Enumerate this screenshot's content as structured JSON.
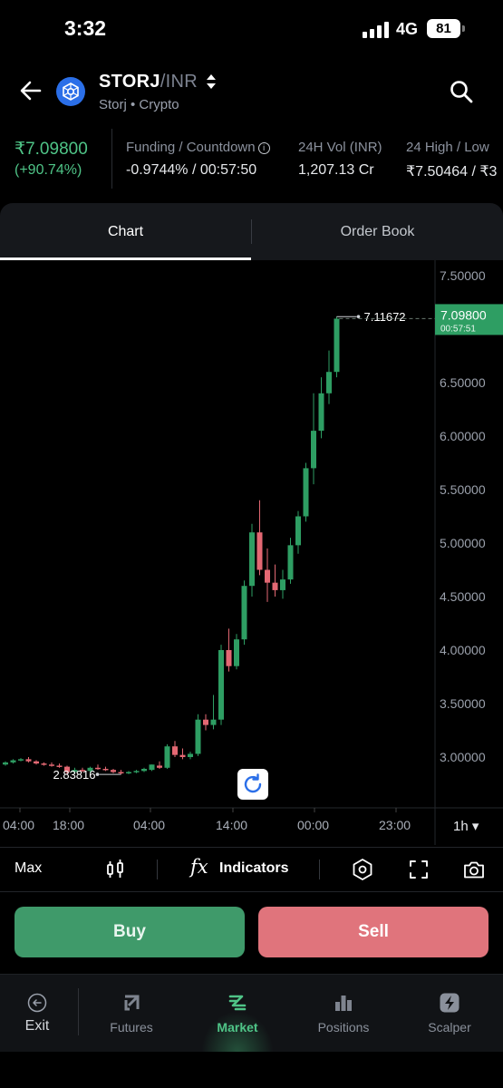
{
  "status_bar": {
    "time": "3:32",
    "network": "4G",
    "battery": "81"
  },
  "header": {
    "base": "STORJ",
    "quote": "/INR",
    "subtitle": "Storj • Crypto",
    "icons": [
      "back-arrow-icon",
      "storj-logo-icon",
      "sort-icon",
      "search-icon"
    ]
  },
  "ticker": {
    "price": "₹7.09800",
    "change": "(+90.74%)",
    "funding_label": "Funding / Countdown",
    "funding_value": "-0.9744% / 00:57:50",
    "vol_label": "24H Vol (INR)",
    "vol_value": "1,207.13 Cr",
    "high_label": "24 High / Low",
    "high_value": "₹7.50464 / ₹3",
    "accent_color": "#4fc487"
  },
  "tabs": {
    "chart": "Chart",
    "order_book": "Order Book",
    "active": "Chart"
  },
  "chart": {
    "timeframe": "1h ▾",
    "current_price_tag": "7.09800",
    "countdown_tag": "00:57:51",
    "high_marker": "7.11672",
    "low_marker": "2.83816",
    "up_color": "#2e9e63",
    "down_color": "#e36873"
  },
  "chart_data": {
    "type": "candlestick",
    "y_ticks": [
      "7.50000",
      "7.00000",
      "6.50000",
      "6.00000",
      "5.50000",
      "5.00000",
      "4.50000",
      "4.00000",
      "3.50000",
      "3.00000"
    ],
    "y_tick_values": [
      7.5,
      7.0,
      6.5,
      6.0,
      5.5,
      5.0,
      4.5,
      4.0,
      3.5,
      3.0
    ],
    "x_ticks": [
      "04:00",
      "18:00",
      "04:00",
      "14:00",
      "00:00",
      "23:00"
    ],
    "ylim": [
      2.55,
      7.75
    ],
    "candles": [
      [
        2.93,
        2.96,
        2.92,
        2.95
      ],
      [
        2.95,
        2.98,
        2.94,
        2.97
      ],
      [
        2.97,
        2.99,
        2.96,
        2.98
      ],
      [
        2.98,
        3.0,
        2.95,
        2.96
      ],
      [
        2.96,
        2.97,
        2.93,
        2.94
      ],
      [
        2.94,
        2.95,
        2.92,
        2.93
      ],
      [
        2.93,
        2.95,
        2.91,
        2.92
      ],
      [
        2.92,
        2.94,
        2.9,
        2.91
      ],
      [
        2.91,
        2.92,
        2.84,
        2.86
      ],
      [
        2.86,
        2.9,
        2.84,
        2.88
      ],
      [
        2.88,
        2.9,
        2.86,
        2.87
      ],
      [
        2.87,
        2.91,
        2.85,
        2.9
      ],
      [
        2.9,
        2.93,
        2.88,
        2.89
      ],
      [
        2.89,
        2.91,
        2.87,
        2.88
      ],
      [
        2.88,
        2.89,
        2.85,
        2.86
      ],
      [
        2.86,
        2.88,
        2.83816,
        2.85
      ],
      [
        2.85,
        2.87,
        2.84,
        2.86
      ],
      [
        2.86,
        2.88,
        2.85,
        2.87
      ],
      [
        2.87,
        2.9,
        2.86,
        2.89
      ],
      [
        2.88,
        2.93,
        2.87,
        2.93
      ],
      [
        2.92,
        2.96,
        2.89,
        2.9
      ],
      [
        2.9,
        3.12,
        2.89,
        3.1
      ],
      [
        3.1,
        3.15,
        3.0,
        3.02
      ],
      [
        3.02,
        3.08,
        2.98,
        3.0
      ],
      [
        3.0,
        3.05,
        2.98,
        3.03
      ],
      [
        3.03,
        3.4,
        3.01,
        3.35
      ],
      [
        3.35,
        3.4,
        3.25,
        3.3
      ],
      [
        3.3,
        3.58,
        3.26,
        3.35
      ],
      [
        3.35,
        4.05,
        3.3,
        4.0
      ],
      [
        4.0,
        4.2,
        3.8,
        3.85
      ],
      [
        3.85,
        4.15,
        3.82,
        4.1
      ],
      [
        4.1,
        4.65,
        4.05,
        4.6
      ],
      [
        4.6,
        5.18,
        4.5,
        5.1
      ],
      [
        5.1,
        5.4,
        4.7,
        4.75
      ],
      [
        4.75,
        4.95,
        4.45,
        4.63
      ],
      [
        4.63,
        4.8,
        4.5,
        4.56
      ],
      [
        4.56,
        4.75,
        4.48,
        4.66
      ],
      [
        4.66,
        5.05,
        4.62,
        4.98
      ],
      [
        4.98,
        5.3,
        4.9,
        5.25
      ],
      [
        5.25,
        5.75,
        5.2,
        5.7
      ],
      [
        5.7,
        6.4,
        5.55,
        6.05
      ],
      [
        6.05,
        6.55,
        5.98,
        6.4
      ],
      [
        6.4,
        6.8,
        6.3,
        6.6
      ],
      [
        6.6,
        7.11672,
        6.55,
        7.098
      ]
    ]
  },
  "toolbar": {
    "max": "Max",
    "fx": "fx",
    "indicators": "Indicators",
    "icons": [
      "candlestick-icon",
      "settings-hexagon-icon",
      "fullscreen-icon",
      "camera-icon"
    ]
  },
  "actions": {
    "buy": "Buy",
    "sell": "Sell"
  },
  "bottom_nav": {
    "items": [
      {
        "label": "Exit",
        "icon": "exit-icon"
      },
      {
        "label": "Futures",
        "icon": "futures-icon"
      },
      {
        "label": "Market",
        "icon": "market-icon"
      },
      {
        "label": "Positions",
        "icon": "positions-icon"
      },
      {
        "label": "Scalper",
        "icon": "scalper-icon"
      }
    ],
    "active": "Market",
    "active_color": "#4fc487"
  }
}
